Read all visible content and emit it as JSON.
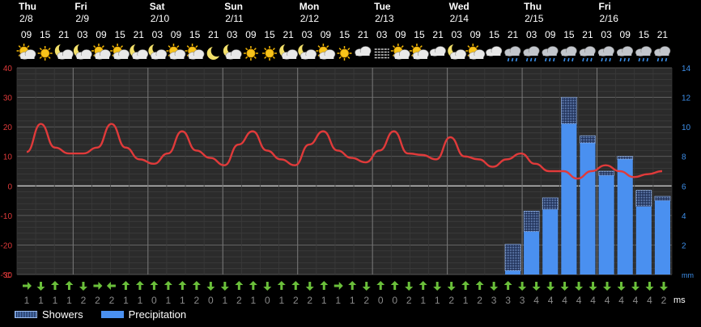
{
  "chart_data": {
    "type": "meteogram",
    "days": [
      {
        "name": "Thu",
        "date": "2/8"
      },
      {
        "name": "Fri",
        "date": "2/9"
      },
      {
        "name": "Sat",
        "date": "2/10"
      },
      {
        "name": "Sun",
        "date": "2/11"
      },
      {
        "name": "Mon",
        "date": "2/12"
      },
      {
        "name": "Tue",
        "date": "2/13"
      },
      {
        "name": "Wed",
        "date": "2/14"
      },
      {
        "name": "Thu",
        "date": "2/15"
      },
      {
        "name": "Fri",
        "date": "2/16"
      }
    ],
    "hours": [
      "09",
      "15",
      "21",
      "03",
      "09",
      "15",
      "21",
      "03",
      "09",
      "15",
      "21",
      "03",
      "09",
      "15",
      "21",
      "03",
      "09",
      "15",
      "21",
      "03",
      "09",
      "15",
      "21",
      "03",
      "09",
      "15",
      "21",
      "03",
      "09",
      "15",
      "21",
      "03",
      "09",
      "15",
      "21"
    ],
    "weather_icons": [
      "partly-sunny-icon",
      "sun-icon",
      "moon-cloud-icon",
      "moon-cloud-icon",
      "partly-sunny-icon",
      "partly-sunny-icon",
      "moon-cloud-icon",
      "moon-cloud-icon",
      "partly-sunny-icon",
      "partly-sunny-icon",
      "moon-icon",
      "moon-cloud-icon",
      "sun-icon",
      "sun-icon",
      "moon-cloud-icon",
      "moon-cloud-icon",
      "partly-sunny-icon",
      "sun-icon",
      "cloud-icon",
      "fog-icon",
      "partly-sunny-icon",
      "partly-sunny-icon",
      "cloud-icon",
      "moon-cloud-icon",
      "partly-sunny-icon",
      "cloud-icon",
      "rain-cloud-icon",
      "rain-cloud-icon",
      "rain-cloud-icon",
      "rain-cloud-icon",
      "rain-cloud-icon",
      "rain-cloud-icon",
      "rain-cloud-icon",
      "rain-cloud-icon",
      "rain-cloud-icon"
    ],
    "temperature": [
      11.5,
      21,
      13,
      11,
      11,
      13,
      21,
      13,
      9,
      7.5,
      11,
      18.5,
      12,
      9.5,
      7,
      14,
      18.5,
      12,
      9,
      7,
      14,
      18.5,
      12,
      9.5,
      8,
      12,
      18.5,
      11,
      10.5,
      9,
      16.5,
      10,
      9,
      6.5,
      9,
      11,
      7.5,
      5,
      5,
      2.5,
      5,
      7,
      5,
      3,
      4,
      5
    ],
    "temperature_axis": {
      "min": -30,
      "max": 40,
      "ticks": [
        "-30",
        "-20",
        "-10",
        "0",
        "10",
        "20",
        "30",
        "40"
      ],
      "unit": "°C"
    },
    "precip_axis": {
      "min": 0,
      "max": 14,
      "ticks": [
        "0",
        "2",
        "4",
        "6",
        "8",
        "10",
        "12",
        "14"
      ],
      "unit": "mm"
    },
    "precipitation": [
      {
        "index": 26,
        "precipitation": 0.25,
        "showers": 1.8
      },
      {
        "index": 27,
        "precipitation": 2.9,
        "showers": 1.4
      },
      {
        "index": 28,
        "precipitation": 4.4,
        "showers": 0.8
      },
      {
        "index": 29,
        "precipitation": 10.2,
        "showers": 1.8
      },
      {
        "index": 30,
        "precipitation": 8.9,
        "showers": 0.5
      },
      {
        "index": 31,
        "precipitation": 6.7,
        "showers": 0.3
      },
      {
        "index": 32,
        "precipitation": 7.8,
        "showers": 0.2
      },
      {
        "index": 33,
        "precipitation": 4.6,
        "showers": 1.1
      },
      {
        "index": 34,
        "precipitation": 5.0,
        "showers": 0.3
      }
    ],
    "wind_arrows": [
      "right",
      "down",
      "up",
      "up",
      "down",
      "right",
      "left",
      "up",
      "up",
      "up",
      "up",
      "up",
      "up",
      "down",
      "down",
      "up",
      "up",
      "down",
      "up",
      "up",
      "down",
      "up",
      "right",
      "up",
      "down",
      "up",
      "up",
      "down",
      "up",
      "down",
      "down",
      "up",
      "up",
      "down",
      "up",
      "down",
      "down",
      "down",
      "down",
      "down",
      "down",
      "down",
      "down",
      "down",
      "down",
      "down"
    ],
    "wind_speeds": [
      "1",
      "1",
      "1",
      "1",
      "2",
      "2",
      "2",
      "1",
      "1",
      "0",
      "1",
      "1",
      "2",
      "0",
      "1",
      "2",
      "1",
      "0",
      "1",
      "2",
      "2",
      "1",
      "1",
      "1",
      "2",
      "0",
      "0",
      "2",
      "1",
      "1",
      "2",
      "1",
      "2",
      "3",
      "3",
      "3",
      "4",
      "4",
      "4",
      "4",
      "4",
      "4",
      "4",
      "4",
      "4",
      "2"
    ],
    "wind_unit": "ms",
    "legend": [
      {
        "label": "Showers",
        "key": "showers"
      },
      {
        "label": "Precipitation",
        "key": "precipitation"
      }
    ],
    "colors": {
      "temperature": "#e03a3a",
      "precipitation": "#4a90f0",
      "showers": "#5a86c8",
      "wind": "#6abf3a",
      "axis_left": "#e03a3a",
      "axis_right": "#3d8ee8"
    }
  }
}
